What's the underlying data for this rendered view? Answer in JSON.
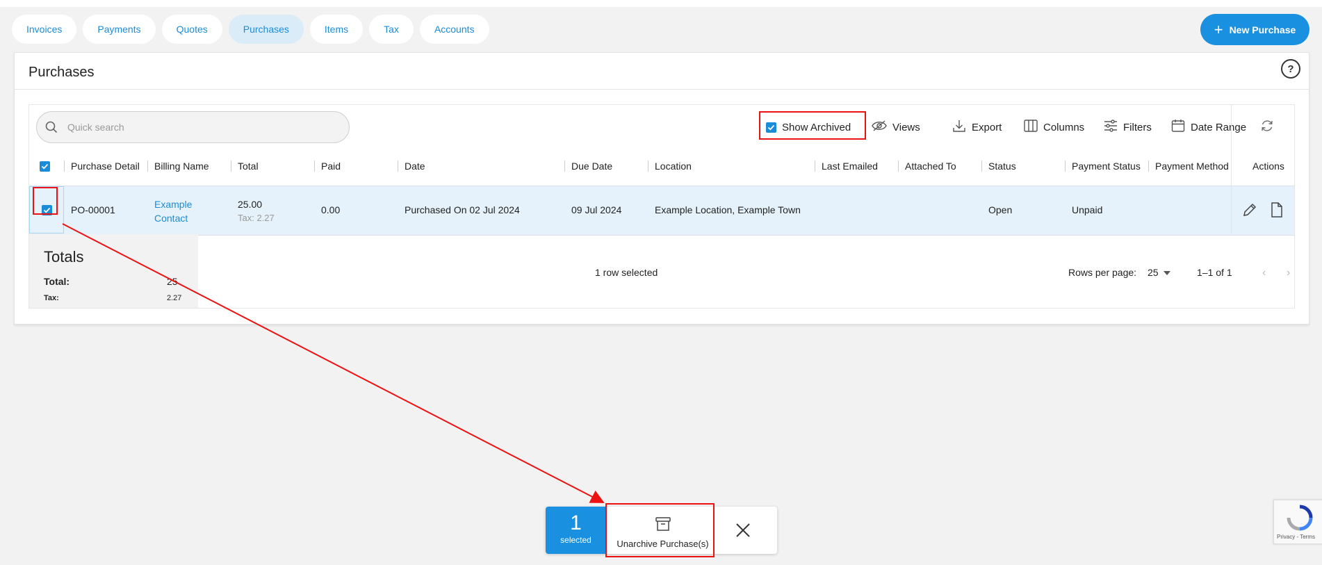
{
  "tabs": [
    {
      "label": "Invoices"
    },
    {
      "label": "Payments"
    },
    {
      "label": "Quotes"
    },
    {
      "label": "Purchases",
      "active": true
    },
    {
      "label": "Items"
    },
    {
      "label": "Tax"
    },
    {
      "label": "Accounts"
    }
  ],
  "new_button": {
    "label": "New Purchase",
    "icon": "plus-icon"
  },
  "page": {
    "title": "Purchases",
    "help_icon": "?"
  },
  "toolbar": {
    "search_placeholder": "Quick search",
    "show_archived": {
      "label": "Show Archived",
      "checked": true
    },
    "views": "Views",
    "export": "Export",
    "columns": "Columns",
    "filters": "Filters",
    "date_range": "Date Range"
  },
  "table": {
    "columns": [
      "Purchase Detail",
      "Billing Name",
      "Total",
      "Paid",
      "Date",
      "Due Date",
      "Location",
      "Last Emailed",
      "Attached To",
      "Status",
      "Payment Status",
      "Payment Method",
      "Actions"
    ],
    "rows": [
      {
        "selected": true,
        "purchase_detail": "PO-00001",
        "billing_name_line1": "Example",
        "billing_name_line2": "Contact",
        "total": "25.00",
        "tax": "Tax: 2.27",
        "paid": "0.00",
        "date": "Purchased On 02 Jul 2024",
        "due_date": "09 Jul 2024",
        "location": "Example Location, Example Town",
        "last_emailed": "",
        "attached_to": "",
        "status": "Open",
        "payment_status": "Unpaid",
        "payment_method": ""
      }
    ]
  },
  "totals": {
    "title": "Totals",
    "total_label": "Total:",
    "total_value": "25",
    "tax_label": "Tax:",
    "tax_value": "2.27"
  },
  "footer": {
    "selected_text": "1 row selected",
    "rows_per_page_label": "Rows per page:",
    "rows_per_page": "25",
    "range": "1–1 of 1"
  },
  "action_bar": {
    "count": "1",
    "count_label": "selected",
    "unarchive_label": "Unarchive Purchase(s)"
  },
  "recaptcha": {
    "text": "Privacy - Terms"
  },
  "colors": {
    "accent": "#1a90e0",
    "link": "#1a8cd8",
    "selected_row": "#e5f2fb",
    "annotation": "#e11111"
  }
}
